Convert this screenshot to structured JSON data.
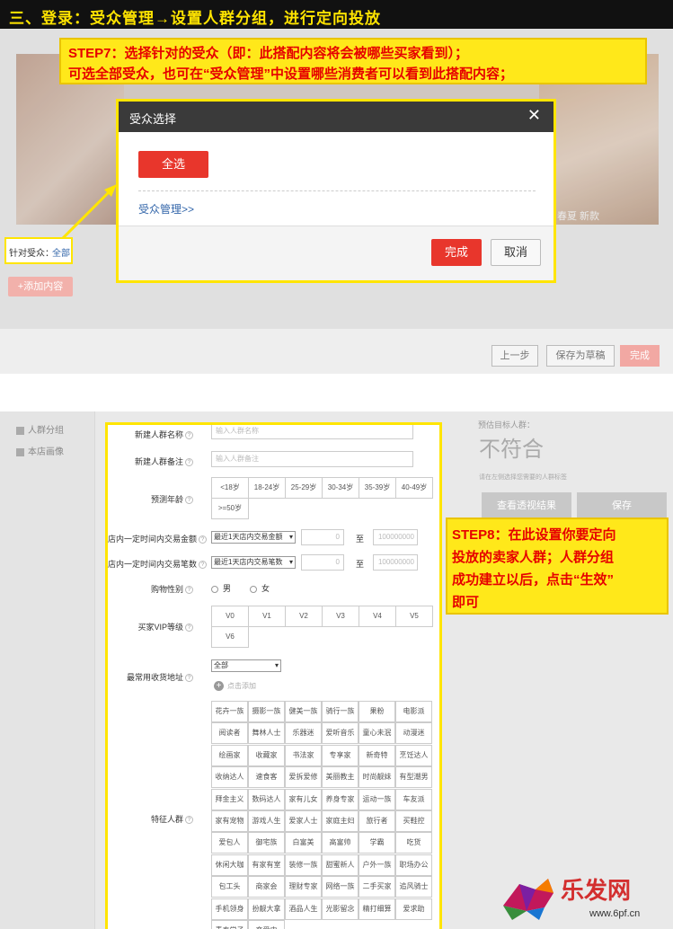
{
  "banner": {
    "title": "三、登录：受众管理→设置人群分组，进行定向投放"
  },
  "step7": {
    "line1": "STEP7：选择针对的受众（即：此搭配内容将会被哪些买家看到）；",
    "line2": "可选全部受众，也可在“受众管理”中设置哪些消费者可以看到此搭配内容；"
  },
  "photo": {
    "caption": "春夏 新款"
  },
  "modal": {
    "title": "受众选择",
    "close": "✕",
    "select_all": "全选",
    "manage_link": "受众管理>>",
    "confirm": "完成",
    "cancel": "取消"
  },
  "target": {
    "label": "针对受众：",
    "value": "全部"
  },
  "add_content": "+添加内容",
  "footer": {
    "prev": "上一步",
    "save_draft": "保存为草稿",
    "finish": "完成"
  },
  "sidebar": {
    "items": [
      {
        "label": "人群分组"
      },
      {
        "label": "本店画像"
      }
    ]
  },
  "form": {
    "group_name": {
      "label": "新建人群名称",
      "placeholder": "输入人群名称"
    },
    "group_note": {
      "label": "新建人群备注",
      "placeholder": "输入人群备注"
    },
    "age": {
      "label": "预测年龄",
      "options": [
        "<18岁",
        "18-24岁",
        "25-29岁",
        "30-34岁",
        "35-39岁",
        "40-49岁",
        ">=50岁"
      ]
    },
    "amount": {
      "label": "店内一定时间内交易金额",
      "select": "最近1天店内交易金额",
      "min": "0",
      "to": "至",
      "max": "100000000"
    },
    "count": {
      "label": "店内一定时间内交易笔数",
      "select": "最近1天店内交易笔数",
      "min": "0",
      "to": "至",
      "max": "100000000"
    },
    "gender": {
      "label": "购物性别",
      "options": [
        "男",
        "女"
      ]
    },
    "vip": {
      "label": "买家VIP等级",
      "options": [
        "V0",
        "V1",
        "V2",
        "V3",
        "V4",
        "V5",
        "V6"
      ]
    },
    "address": {
      "label": "最常用收货地址",
      "select": "全部",
      "add": "点击添加"
    },
    "tags": {
      "label": "特征人群",
      "items": [
        "花卉一族",
        "摄影一族",
        "健美一族",
        "骑行一族",
        "果粉",
        "电影派",
        "阅读者",
        "舞林人士",
        "乐器迷",
        "爱听音乐",
        "童心未泯",
        "动漫迷",
        "绘画家",
        "收藏家",
        "书法家",
        "专享家",
        "新奇特",
        "烹饪达人",
        "收纳达人",
        "速食客",
        "爱拆爱修",
        "美丽教主",
        "时尚靓妹",
        "有型潮男",
        "拜金主义",
        "数码达人",
        "家有儿女",
        "养身专家",
        "运动一族",
        "车友派",
        "家有宠物",
        "游戏人生",
        "爱家人士",
        "家庭主妇",
        "旅行者",
        "买鞋控",
        "爱包人",
        "御宅族",
        "白富美",
        "高富帅",
        "学霸",
        "吃货",
        "休闲大咖",
        "有家有室",
        "装修一族",
        "甜蜜新人",
        "户外一族",
        "职场办公",
        "包工头",
        "商家会",
        "理财专家",
        "网络一族",
        "二手买家",
        "追风骑士",
        "手机领身",
        "扮靓大拿",
        "酒品人生",
        "光影留念",
        "精打细算",
        "爱求助",
        "青春学子",
        "恋爱中"
      ]
    }
  },
  "estimate": {
    "label": "预估目标人群：",
    "value": "不符合",
    "note": "请在左侧选择您需要的人群标签",
    "view_btn": "查看透视结果",
    "save_btn": "保存"
  },
  "step8": {
    "line1": "STEP8：在此设置你要定向",
    "line2": "投放的卖家人群；人群分组",
    "line3": "成功建立以后，点击“生效”",
    "line4": "即可"
  },
  "logo": {
    "text": "乐发网",
    "url_text": "www.6pf.cn"
  },
  "colors": {
    "accent": "#e8362c",
    "highlight": "#ffe81a",
    "note_red": "#e60000",
    "link": "#3366aa"
  }
}
